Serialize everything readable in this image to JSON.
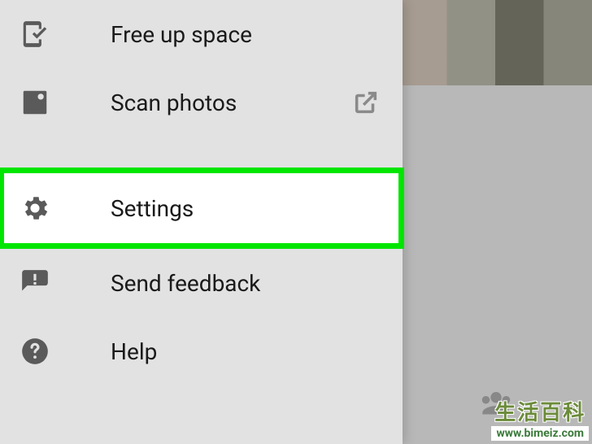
{
  "drawer": {
    "items": [
      {
        "icon": "phone-check",
        "label": "Free up space",
        "highlighted": false,
        "external": false
      },
      {
        "icon": "photo-scan",
        "label": "Scan photos",
        "highlighted": false,
        "external": true
      },
      {
        "icon": "settings-gear",
        "label": "Settings",
        "highlighted": true,
        "external": false
      },
      {
        "icon": "feedback-bubble",
        "label": "Send feedback",
        "highlighted": false,
        "external": false
      },
      {
        "icon": "help-circle",
        "label": "Help",
        "highlighted": false,
        "external": false
      }
    ]
  },
  "watermark": {
    "text": "生活百科",
    "url": "www.bimeiz.com"
  },
  "colors": {
    "highlight_border": "#00e600",
    "highlight_bg": "#ffffff",
    "drawer_bg": "#e2e2e2",
    "icon_color": "#5a5a5a",
    "text_color": "#1a1a1a"
  }
}
